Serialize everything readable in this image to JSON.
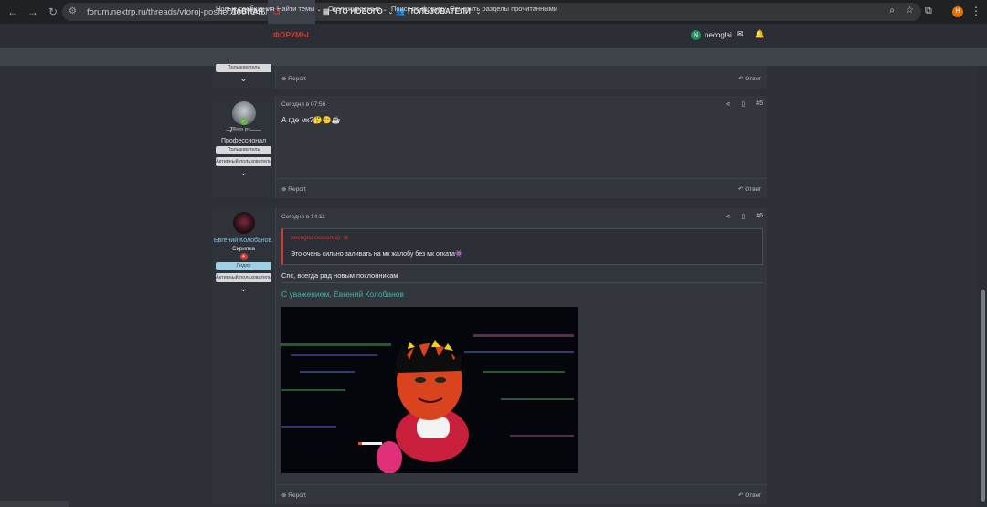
{
  "browser": {
    "url": "forum.nextrp.ru/threads/vtoroj-poshel.1007345/",
    "profile_initial": "H"
  },
  "topnav": {
    "home": "ГЛАВНАЯ",
    "forums": "ФОРУМЫ",
    "whats_new": "ЧТО НОВОГО",
    "members": "ПОЛЬЗОВАТЕЛИ",
    "username": "necoglai",
    "user_initial": "N"
  },
  "subnav": {
    "items": [
      "Новые сообщения",
      "Найти темы",
      "Отслеживаемые",
      "Поиск по форуму",
      "Отметить разделы прочитанными"
    ]
  },
  "post_top": {
    "badge": "Пользователь",
    "report": "Report",
    "reply": "Ответ"
  },
  "post5": {
    "username": "—̷̸̸͟͟͞͞ ˢᵗᵃᵗᵘˢ ᵖʳᵒ——",
    "title": "Профессионал",
    "badge1": "Пользователь",
    "badge2": "Активный пользователь",
    "date": "Сегодня в 07:56",
    "number": "#5",
    "text": "А где мк?🤔😕☕",
    "report": "Report",
    "reply": "Ответ"
  },
  "post6": {
    "username": "Евгений Колобанов.",
    "title": "Скрипка",
    "badge1": "Лидер",
    "badge2": "Активный пользователь",
    "date": "Сегодня в 14:11",
    "number": "#6",
    "quote_author": "necoglai сказал(а): ⊕",
    "quote_text": "Это очень сильно заливать на мк жалобу без мк отката👾",
    "text": "Спс, всегда рад новым поклонникам",
    "signature": "С уважением, Евгений Колобанов",
    "report": "Report",
    "reply": "Ответ"
  },
  "colors": {
    "accent_red": "#d8382e",
    "signature_teal": "#3bb5a4",
    "leader_badge": "#9fcfe4"
  }
}
